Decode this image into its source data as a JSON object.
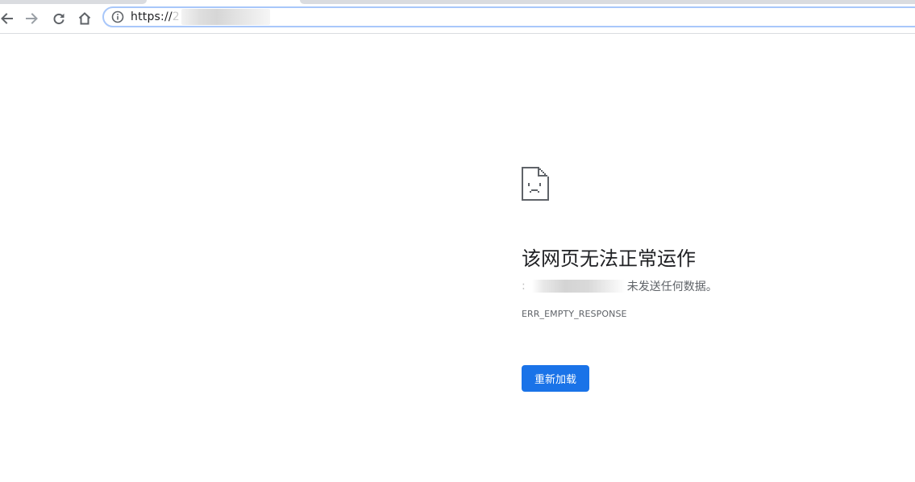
{
  "browser": {
    "url_prefix": "https://",
    "url_hidden_char": "2",
    "icons": {
      "back": "back-arrow-icon",
      "forward": "forward-arrow-icon",
      "reload": "reload-icon",
      "home": "home-icon",
      "site_info": "info-icon"
    }
  },
  "error": {
    "icon": "sad-document-icon",
    "title": "该网页无法正常运作",
    "desc_prefix": ":",
    "desc_suffix": "未发送任何数据。",
    "code": "ERR_EMPTY_RESPONSE",
    "reload_label": "重新加载"
  },
  "colors": {
    "accent": "#1a73e8",
    "omnibox_border": "#a8c7fa",
    "title_text": "#202124",
    "secondary_text": "#5f6368",
    "icon_gray": "#5f6368"
  }
}
